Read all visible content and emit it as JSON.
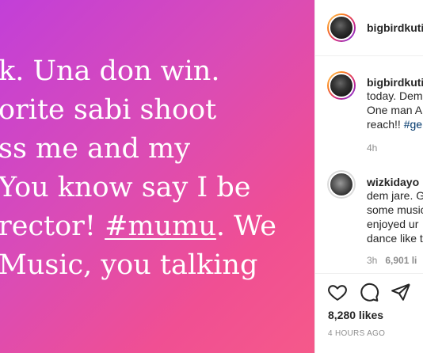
{
  "post_image": {
    "lines": [
      "k. Una don win.",
      "orite sabi shoot",
      "ss me and my",
      "You know say I be",
      "rector!",
      "#mumu",
      ". We",
      "Music, you talking"
    ]
  },
  "header": {
    "username": "bigbirdkuti"
  },
  "caption": {
    "username": "bigbirdkuti",
    "line1": "today. Dem",
    "line2": "One man A",
    "line3": "reach!!",
    "hashtag": "#ge",
    "time": "4h"
  },
  "comment": {
    "username": "wizkidayo",
    "line1": "dem jare. G",
    "line2": "some music",
    "line3": "enjoyed ur",
    "line4": "dance like t",
    "time": "3h",
    "likes": "6,901 li"
  },
  "actions": {
    "likes_count": "8,280 likes",
    "time_ago": "4 HOURS AGO"
  },
  "colors": {
    "gradient_start": "#c23fd8",
    "gradient_end": "#f5598a",
    "link": "#00376b",
    "muted": "#8e8e8e"
  },
  "icons": [
    "heart-icon",
    "comment-icon",
    "share-icon"
  ]
}
